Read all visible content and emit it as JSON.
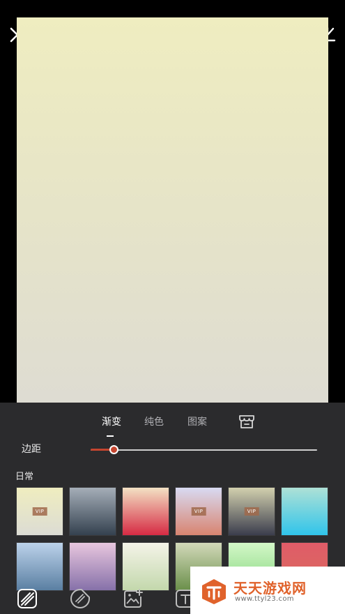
{
  "tabs": [
    {
      "label": "渐变",
      "active": true
    },
    {
      "label": "纯色",
      "active": false
    },
    {
      "label": "图案",
      "active": false
    }
  ],
  "icons": {
    "close": "close-icon",
    "download": "download-icon",
    "store": "store-icon",
    "tools": [
      "background-pattern-icon",
      "sticker-icon",
      "add-image-icon",
      "text-icon"
    ]
  },
  "margin": {
    "label": "边距",
    "value_fraction": 0.1
  },
  "section": {
    "label": "日常"
  },
  "swatches": [
    {
      "colors": [
        "#efedbf",
        "#dcdcd4"
      ],
      "vip": "VIP"
    },
    {
      "colors": [
        "#a5aeb8",
        "#34414f"
      ],
      "vip": ""
    },
    {
      "colors": [
        "#f3e1c4",
        "#d62a43"
      ],
      "vip": ""
    },
    {
      "colors": [
        "#d8daf2",
        "#d88470"
      ],
      "vip": "VIP"
    },
    {
      "colors": [
        "#d2d0ae",
        "#3b3d4d"
      ],
      "vip": "VIP"
    },
    {
      "colors": [
        "#aee1d6",
        "#30c4ea"
      ],
      "vip": ""
    },
    {
      "colors": [
        "#bcd2ea",
        "#5a7fa2"
      ],
      "vip": ""
    },
    {
      "colors": [
        "#e8c6de",
        "#8671a9"
      ],
      "vip": ""
    },
    {
      "colors": [
        "#f4f3e8",
        "#c3d8ac"
      ],
      "vip": ""
    },
    {
      "colors": [
        "#d3d9ba",
        "#6a8f4a"
      ],
      "vip": ""
    },
    {
      "colors": [
        "#d3f7c8",
        "#86d67e"
      ],
      "vip": ""
    },
    {
      "colors": [
        "#e05c68",
        "#d96b5e"
      ],
      "vip": ""
    }
  ],
  "watermark": {
    "title": "天天游戏网",
    "url": "www.ttyl23.com"
  },
  "colors": {
    "accent": "#c5452f",
    "panel": "#2b2b2d",
    "watermark_orange": "#e0622b"
  }
}
